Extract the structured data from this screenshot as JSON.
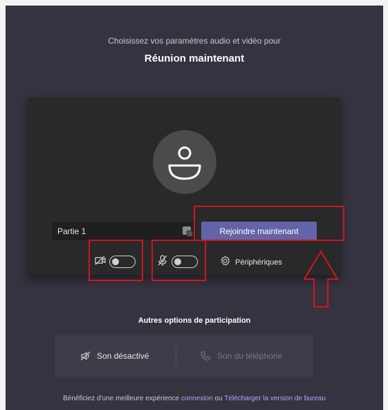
{
  "header": {
    "subtitle": "Choisissez vos paramètres audio et vidéo pour",
    "meeting_title": "Réunion maintenant"
  },
  "preview": {
    "name_value": "Partie 1",
    "join_label": "Rejoindre maintenant",
    "devices_label": "Périphériques",
    "camera_toggle": "off",
    "mic_toggle": "off"
  },
  "other_options": {
    "label": "Autres options de participation",
    "audio_off_label": "Son désactivé",
    "phone_audio_label": "Son du téléphone"
  },
  "footer": {
    "prefix": "Bénéficiez d'une meilleure expérience",
    "connexion_link": "connexion",
    "or": "ou",
    "download_link": "Télécharger la version de bureau"
  },
  "colors": {
    "background": "#35333f",
    "preview_bg": "#292929",
    "accent": "#6264a7",
    "highlight": "#d2141e",
    "link": "#a9aaff"
  }
}
